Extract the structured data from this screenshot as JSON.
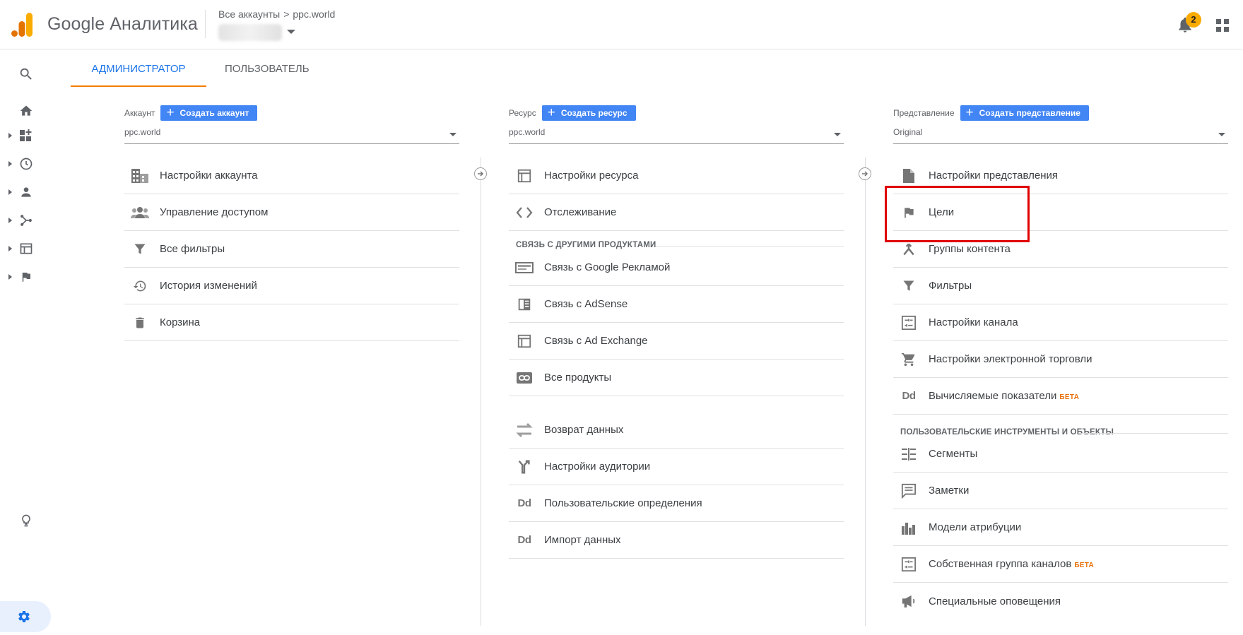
{
  "header": {
    "app_title": "Google Аналитика",
    "breadcrumb_all": "Все аккаунты",
    "breadcrumb_sep": ">",
    "breadcrumb_account": "ppc.world",
    "notification_count": "2"
  },
  "tabs": [
    {
      "label": "АДМИНИСТРАТОР",
      "active": true
    },
    {
      "label": "ПОЛЬЗОВАТЕЛЬ",
      "active": false
    }
  ],
  "account": {
    "label": "Аккаунт",
    "create_label": "Создать аккаунт",
    "selected": "ppc.world",
    "items": [
      {
        "label": "Настройки аккаунта",
        "icon": "building-icon"
      },
      {
        "label": "Управление доступом",
        "icon": "people-icon"
      },
      {
        "label": "Все фильтры",
        "icon": "filter-icon"
      },
      {
        "label": "История изменений",
        "icon": "history-icon"
      },
      {
        "label": "Корзина",
        "icon": "trash-icon"
      }
    ]
  },
  "property": {
    "label": "Ресурс",
    "create_label": "Создать ресурс",
    "selected": "ppc.world",
    "items": [
      {
        "label": "Настройки ресурса",
        "icon": "window-icon"
      },
      {
        "label": "Отслеживание",
        "icon": "code-icon"
      }
    ],
    "section_title": "СВЯЗЬ С ДРУГИМИ ПРОДУКТАМИ",
    "link_items": [
      {
        "label": "Связь с Google Рекламой",
        "icon": "ads-icon"
      },
      {
        "label": "Связь с AdSense",
        "icon": "adsense-icon"
      },
      {
        "label": "Связь с Ad Exchange",
        "icon": "adexchange-icon"
      },
      {
        "label": "Все продукты",
        "icon": "link-icon"
      }
    ],
    "other_items": [
      {
        "label": "Возврат данных",
        "icon": "data-return-icon"
      },
      {
        "label": "Настройки аудитории",
        "icon": "audience-icon"
      },
      {
        "label": "Пользовательские определения",
        "icon": "dd-icon",
        "icon_text": "Dd"
      },
      {
        "label": "Импорт данных",
        "icon": "dd-icon",
        "icon_text": "Dd"
      }
    ]
  },
  "view": {
    "label": "Представление",
    "create_label": "Создать представление",
    "selected": "Original",
    "items": [
      {
        "label": "Настройки представления",
        "icon": "document-icon"
      },
      {
        "label": "Цели",
        "icon": "flag-icon"
      },
      {
        "label": "Группы контента",
        "icon": "content-group-icon"
      },
      {
        "label": "Фильтры",
        "icon": "filter-icon"
      },
      {
        "label": "Настройки канала",
        "icon": "channel-icon"
      },
      {
        "label": "Настройки электронной торговли",
        "icon": "cart-icon"
      },
      {
        "label": "Вычисляемые показатели",
        "icon": "dd-icon",
        "icon_text": "Dd",
        "badge": "БЕТА"
      }
    ],
    "section_title": "ПОЛЬЗОВАТЕЛЬСКИЕ ИНСТРУМЕНТЫ И ОБЪЕКТЫ",
    "tool_items": [
      {
        "label": "Сегменты",
        "icon": "segments-icon"
      },
      {
        "label": "Заметки",
        "icon": "notes-icon"
      },
      {
        "label": "Модели атрибуции",
        "icon": "attribution-icon"
      },
      {
        "label": "Собственная группа каналов",
        "icon": "channel-icon",
        "badge": "БЕТА"
      },
      {
        "label": "Специальные оповещения",
        "icon": "megaphone-icon"
      }
    ]
  },
  "colors": {
    "accent_blue": "#1a73e8",
    "button_blue": "#4285f4",
    "tab_underline": "#f57c00",
    "highlight_red": "#e00000",
    "beta_orange": "#e8710a",
    "badge_yellow": "#f9ab00"
  }
}
